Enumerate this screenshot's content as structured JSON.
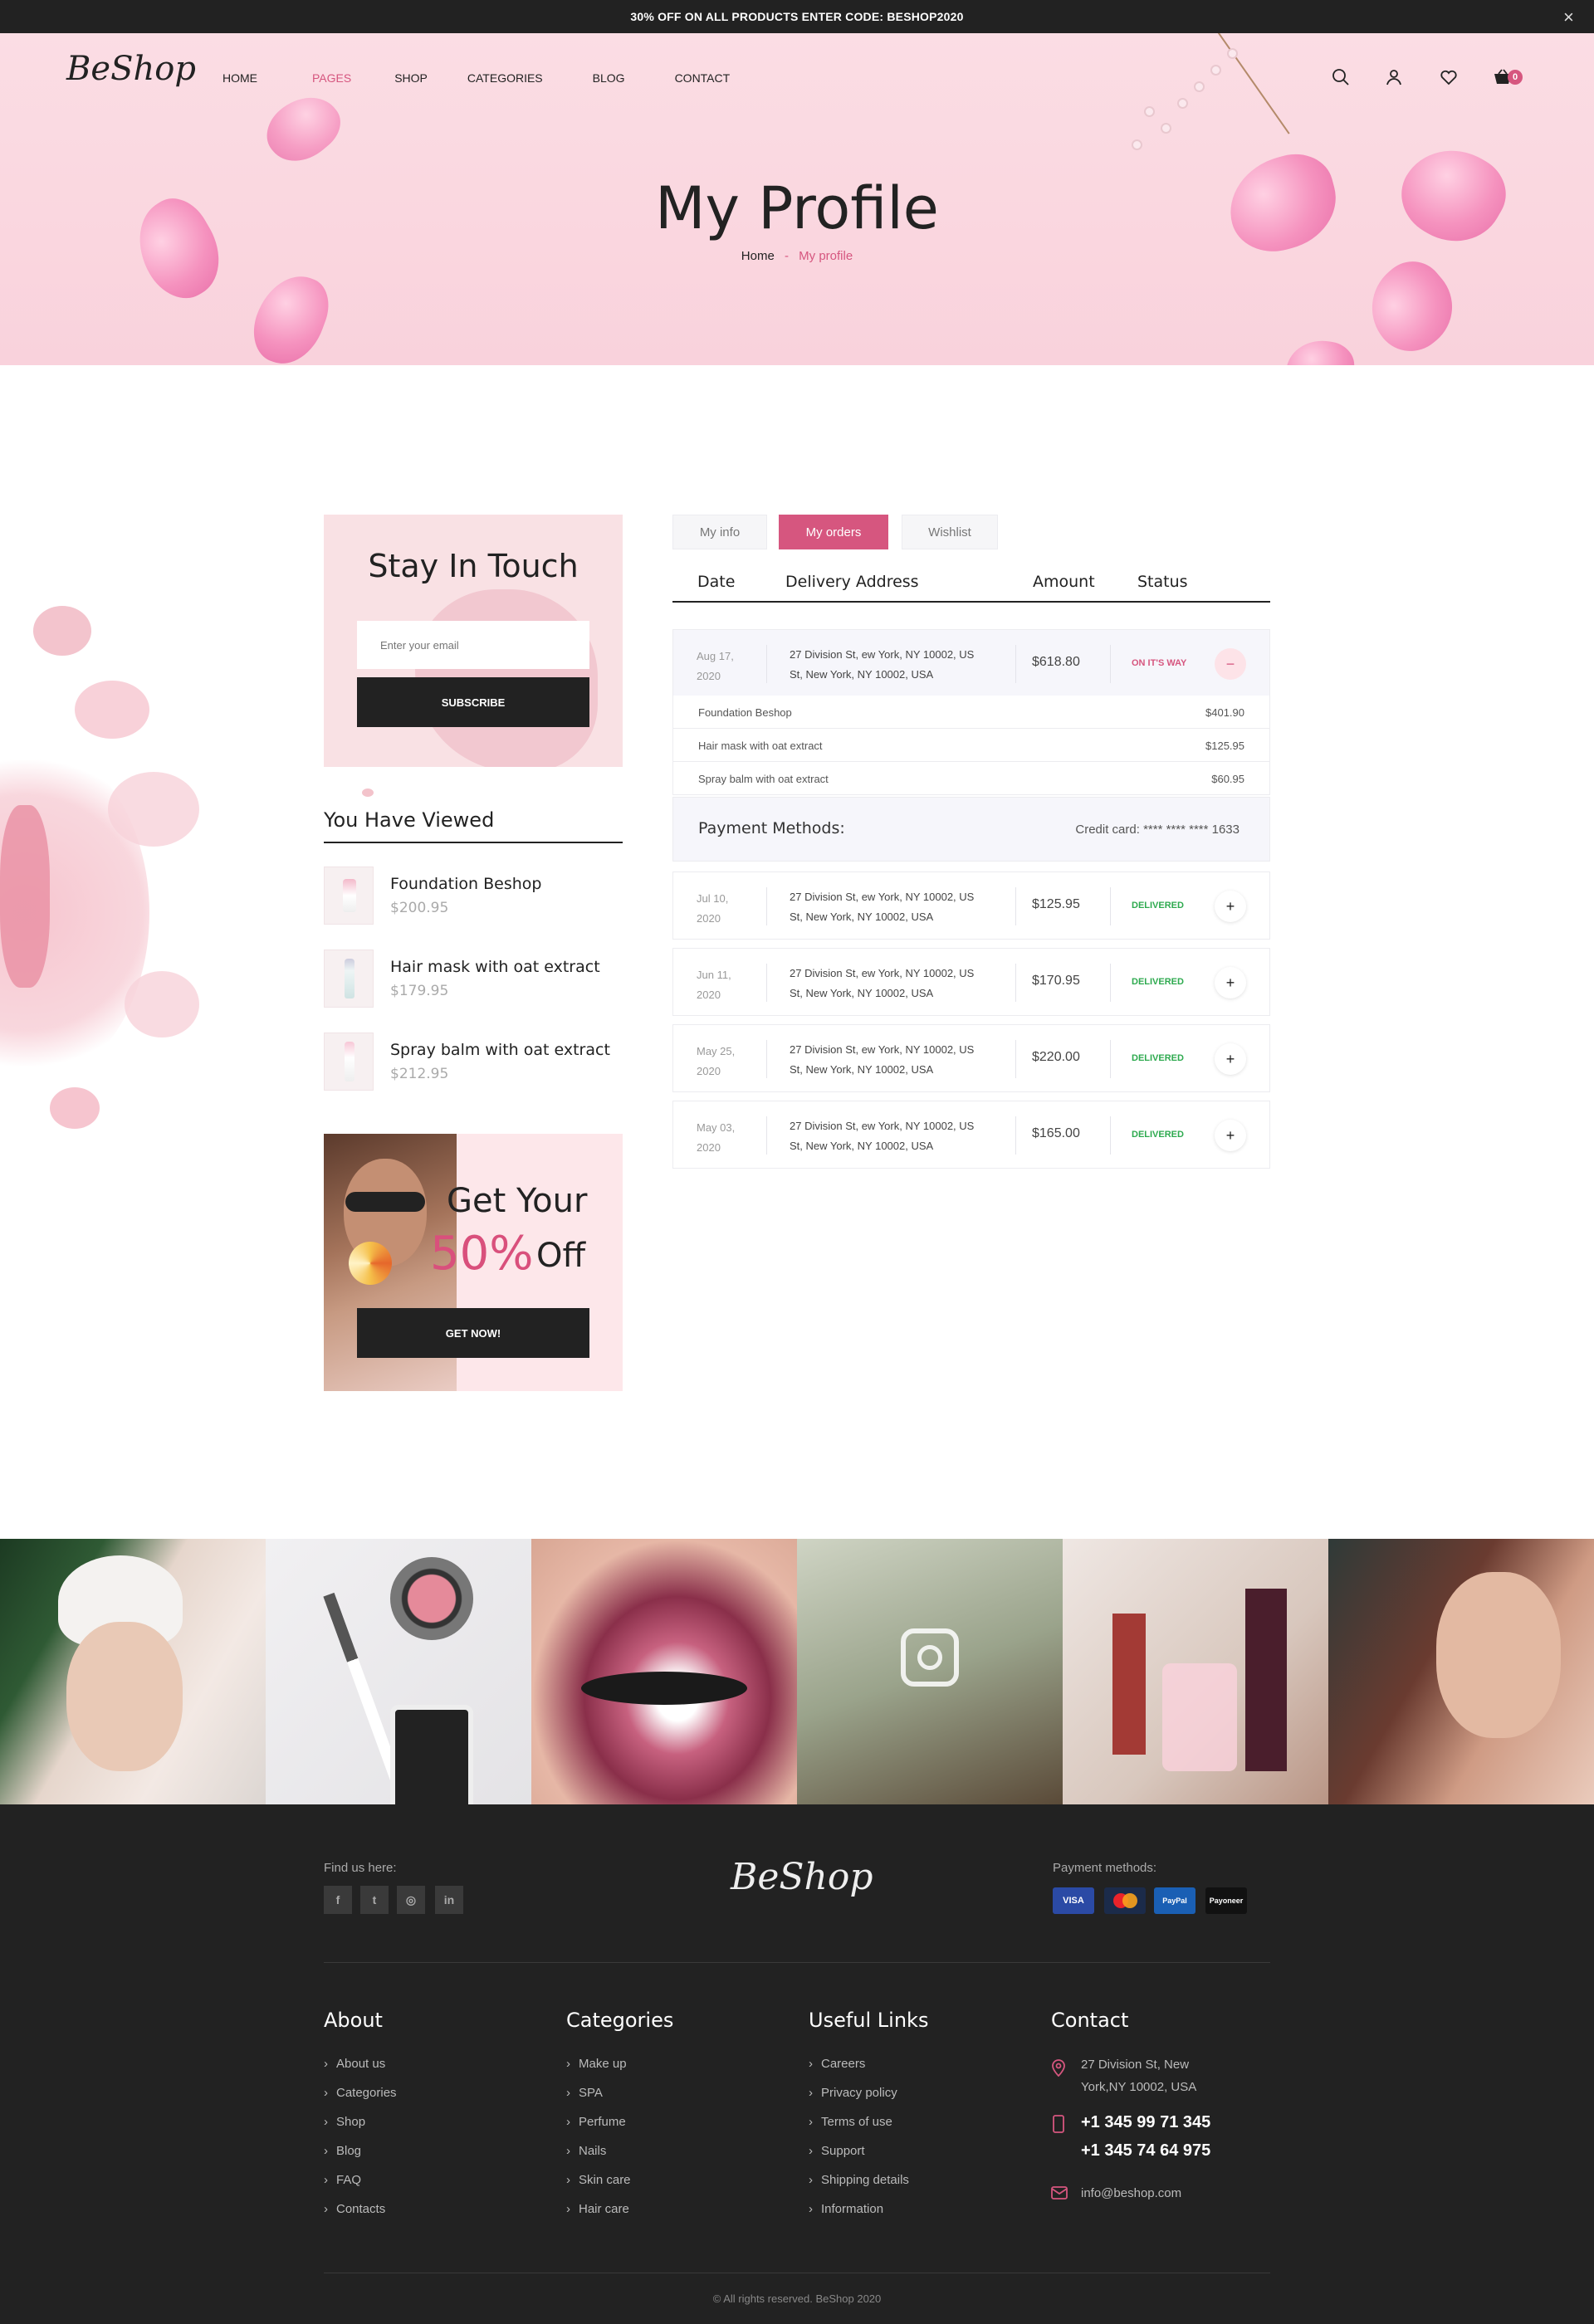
{
  "topbar": {
    "promo": "30% OFF ON ALL PRODUCTS ENTER CODE: BESHOP2020",
    "close": "×"
  },
  "header": {
    "logo": "BeShop",
    "nav": [
      {
        "label": "HOME",
        "active": false
      },
      {
        "label": "PAGES",
        "active": true
      },
      {
        "label": "SHOP",
        "active": false
      },
      {
        "label": "CATEGORIES",
        "active": false
      },
      {
        "label": "BLOG",
        "active": false
      },
      {
        "label": "CONTACT",
        "active": false
      }
    ],
    "icons": [
      "search-icon",
      "user-icon",
      "heart-icon",
      "cart-icon"
    ],
    "cart_count": "0"
  },
  "hero": {
    "title": "My Profile",
    "breadcrumb_home": "Home",
    "breadcrumb_sep": "-",
    "breadcrumb_current": "My profile"
  },
  "subscribe": {
    "title": "Stay In Touch",
    "placeholder": "Enter your email",
    "button": "SUBSCRIBE"
  },
  "viewed": {
    "title": "You Have Viewed",
    "items": [
      {
        "name": "Foundation Beshop",
        "price": "$200.95"
      },
      {
        "name": "Hair mask with oat extract",
        "price": "$179.95"
      },
      {
        "name": "Spray balm with oat extract",
        "price": "$212.95"
      }
    ]
  },
  "promo": {
    "line1": "Get Your",
    "percent": "50%",
    "off": "Off",
    "button": "GET NOW!"
  },
  "profile_tabs": [
    {
      "label": "My info",
      "active": false
    },
    {
      "label": "My orders",
      "active": true
    },
    {
      "label": "Wishlist",
      "active": false
    }
  ],
  "orders_table": {
    "headers": [
      "Date",
      "Delivery Address",
      "Amount",
      "Status"
    ],
    "expanded_order": {
      "date_line1": "Aug 17,",
      "date_line2": "2020",
      "addr_line1": "27 Division St,  ew York, NY 10002, US",
      "addr_line2": "St,  New York, NY 10002, USA",
      "amount": "$618.80",
      "status": "ON IT'S WAY",
      "toggle": "−",
      "items": [
        {
          "name": "Foundation Beshop",
          "price": "$401.90"
        },
        {
          "name": "Hair mask with oat extract",
          "price": "$125.95"
        },
        {
          "name": "Spray balm with oat extract",
          "price": "$60.95"
        }
      ],
      "payment_label": "Payment Methods:",
      "payment_value": "Credit card: **** **** **** 1633"
    },
    "orders": [
      {
        "date_line1": "Jul 10,",
        "date_line2": "2020",
        "addr_line1": "27 Division St,  ew York, NY 10002, US",
        "addr_line2": "St,  New York, NY 10002, USA",
        "amount": "$125.95",
        "status": "DELIVERED",
        "toggle": "+"
      },
      {
        "date_line1": "Jun 11,",
        "date_line2": "2020",
        "addr_line1": "27 Division St,  ew York, NY 10002, US",
        "addr_line2": "St,  New York, NY 10002, USA",
        "amount": "$170.95",
        "status": "DELIVERED",
        "toggle": "+"
      },
      {
        "date_line1": "May 25,",
        "date_line2": "2020",
        "addr_line1": "27 Division St,  ew York, NY 10002, US",
        "addr_line2": "St,  New York, NY 10002, USA",
        "amount": "$220.00",
        "status": "DELIVERED",
        "toggle": "+"
      },
      {
        "date_line1": "May 03,",
        "date_line2": "2020",
        "addr_line1": "27 Division St,  ew York, NY 10002, US",
        "addr_line2": "St,  New York, NY 10002, USA",
        "amount": "$165.00",
        "status": "DELIVERED",
        "toggle": "+"
      }
    ]
  },
  "gallery": {
    "images": [
      "face-mask-photo",
      "makeup-brush-photo",
      "eye-shadow-photo",
      "instagram-photo",
      "perfume-lipstick-photo",
      "model-makeup-photo"
    ],
    "overlay_icon": "instagram-icon"
  },
  "footer": {
    "find_us": "Find us here:",
    "social": [
      {
        "icon": "facebook-icon",
        "glyph": "f"
      },
      {
        "icon": "twitter-icon",
        "glyph": "t"
      },
      {
        "icon": "instagram-icon",
        "glyph": "◎"
      },
      {
        "icon": "linkedin-icon",
        "glyph": "in"
      }
    ],
    "logo": "BeShop",
    "payment_label": "Payment methods:",
    "payment_methods": [
      "VISA",
      "",
      "PayPal",
      "Payoneer"
    ],
    "columns": [
      {
        "title": "About",
        "links": [
          "About us",
          "Categories",
          "Shop",
          "Blog",
          "FAQ",
          "Contacts"
        ]
      },
      {
        "title": "Categories",
        "links": [
          "Make up",
          "SPA",
          "Perfume",
          "Nails",
          "Skin care",
          "Hair care"
        ]
      },
      {
        "title": "Useful Links",
        "links": [
          "Careers",
          "Privacy policy",
          "Terms of use",
          "Support",
          "Shipping details",
          "Information"
        ]
      }
    ],
    "contact": {
      "title": "Contact",
      "address_line1": "27 Division St, New",
      "address_line2": "York,NY 10002, USA",
      "phone1": "+1 345 99 71 345",
      "phone2": "+1 345 74 64 975",
      "email": "info@beshop.com"
    },
    "copyright": "© All rights reserved. BeShop 2020"
  },
  "colors": {
    "accent": "#d6567f",
    "dark": "#222222",
    "delivered": "#2eaa4f",
    "hero_bg": "#fbdde4"
  }
}
